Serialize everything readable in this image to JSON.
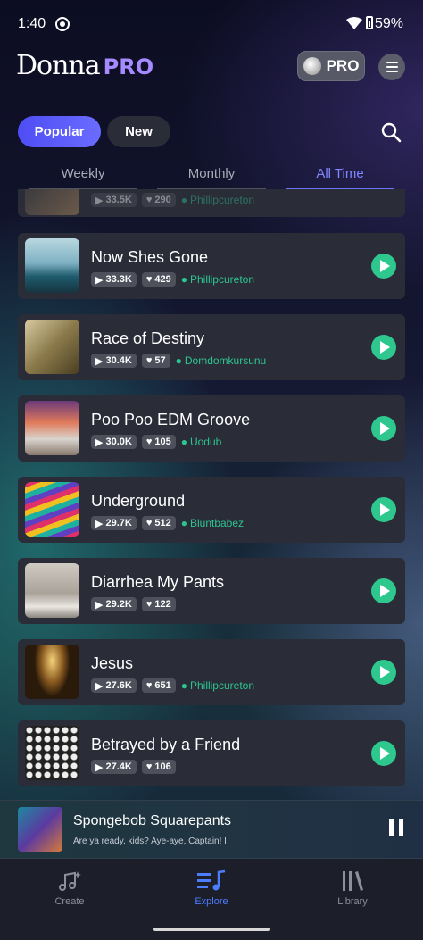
{
  "status_bar": {
    "time": "1:40",
    "battery": "59%"
  },
  "header": {
    "logo_text": "Donna",
    "logo_pro": "PRO",
    "pro_button_label": "PRO"
  },
  "filters": {
    "popular_label": "Popular",
    "new_label": "New"
  },
  "tabs": [
    "Weekly",
    "Monthly",
    "All Time"
  ],
  "partial_item": {
    "plays": "33.5K",
    "likes": "290",
    "author": "Phillipcureton"
  },
  "songs": [
    {
      "title": "Now Shes Gone",
      "plays": "33.3K",
      "likes": "429",
      "author": "Phillipcureton"
    },
    {
      "title": "Race of Destiny",
      "plays": "30.4K",
      "likes": "57",
      "author": "Domdomkursunu"
    },
    {
      "title": "Poo Poo EDM Groove",
      "plays": "30.0K",
      "likes": "105",
      "author": "Uodub"
    },
    {
      "title": "Underground",
      "plays": "29.7K",
      "likes": "512",
      "author": "Bluntbabez"
    },
    {
      "title": "Diarrhea My Pants",
      "plays": "29.2K",
      "likes": "122",
      "author": ""
    },
    {
      "title": "Jesus",
      "plays": "27.6K",
      "likes": "651",
      "author": "Phillipcureton"
    },
    {
      "title": "Betrayed by a Friend",
      "plays": "27.4K",
      "likes": "106",
      "author": ""
    }
  ],
  "now_playing": {
    "title": "Spongebob Squarepants",
    "subtitle": "Are ya ready, kids? Aye-aye, Captain! I"
  },
  "bottom_nav": {
    "create": "Create",
    "explore": "Explore",
    "library": "Library"
  },
  "colors": {
    "accent_blue": "#5b5cff",
    "play_green": "#2ec88f",
    "card_bg": "#2a2c38"
  },
  "icons": {
    "search": "search-icon",
    "menu": "hamburger-menu-icon",
    "play": "play-icon",
    "pause": "pause-icon"
  }
}
